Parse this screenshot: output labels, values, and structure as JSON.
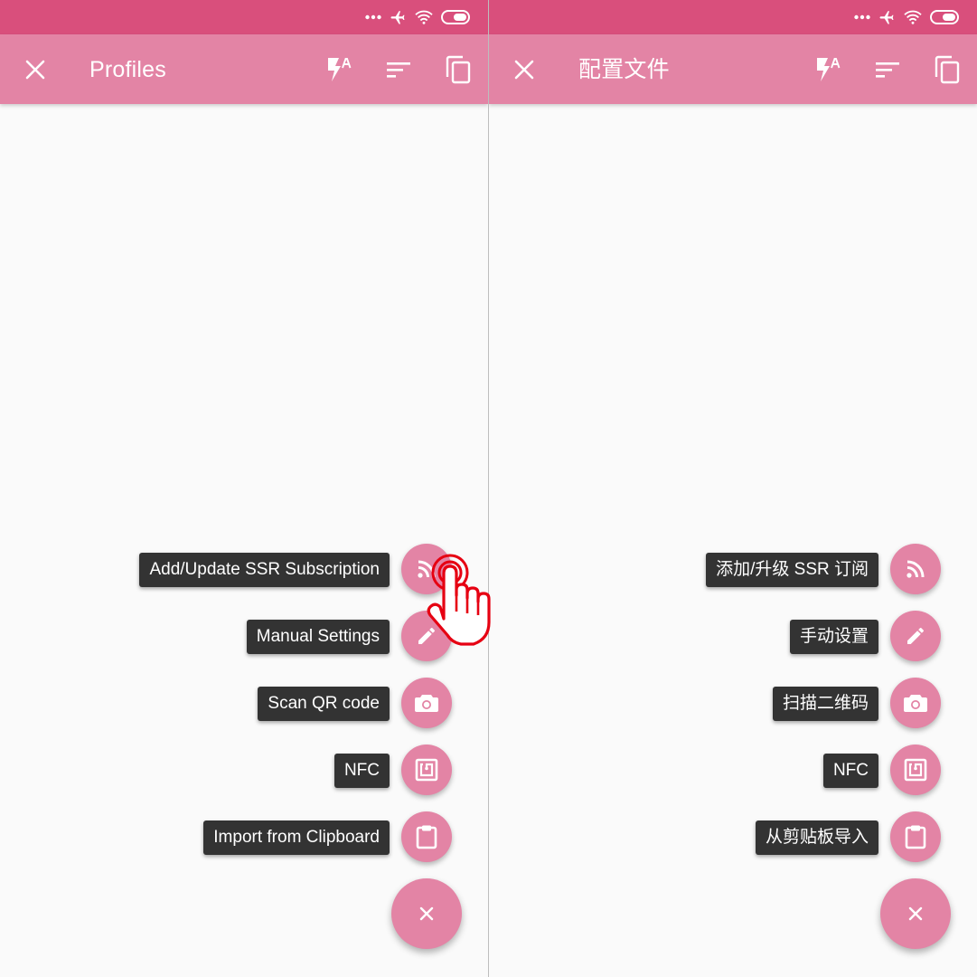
{
  "colors": {
    "status_bar": "#d94f7c",
    "toolbar": "#e384a5",
    "fab": "#e384a5",
    "label_bg": "#333333",
    "background": "#fafafa",
    "pointer_outline": "#e60012"
  },
  "left_screen": {
    "toolbar": {
      "title": "Profiles",
      "actions": [
        "close-icon",
        "flash-auto-icon",
        "sort-icon",
        "copy-icon"
      ]
    },
    "fab_menu": [
      {
        "label": "Add/Update SSR Subscription",
        "icon": "rss-icon"
      },
      {
        "label": "Manual Settings",
        "icon": "pencil-icon"
      },
      {
        "label": "Scan QR code",
        "icon": "camera-icon"
      },
      {
        "label": "NFC",
        "icon": "nfc-icon"
      },
      {
        "label": "Import from Clipboard",
        "icon": "clipboard-icon"
      }
    ],
    "fab_main_icon": "close-icon"
  },
  "right_screen": {
    "toolbar": {
      "title": "配置文件",
      "actions": [
        "close-icon",
        "flash-auto-icon",
        "sort-icon",
        "copy-icon"
      ]
    },
    "fab_menu": [
      {
        "label": "添加/升级 SSR 订阅",
        "icon": "rss-icon"
      },
      {
        "label": "手动设置",
        "icon": "pencil-icon"
      },
      {
        "label": "扫描二维码",
        "icon": "camera-icon"
      },
      {
        "label": "NFC",
        "icon": "nfc-icon"
      },
      {
        "label": "从剪贴板导入",
        "icon": "clipboard-icon"
      }
    ],
    "fab_main_icon": "close-icon"
  },
  "status_bar_icons": [
    "more-dots-icon",
    "airplane-icon",
    "wifi-icon",
    "battery-icon"
  ],
  "annotation": {
    "icon": "pointer-hand-icon"
  }
}
